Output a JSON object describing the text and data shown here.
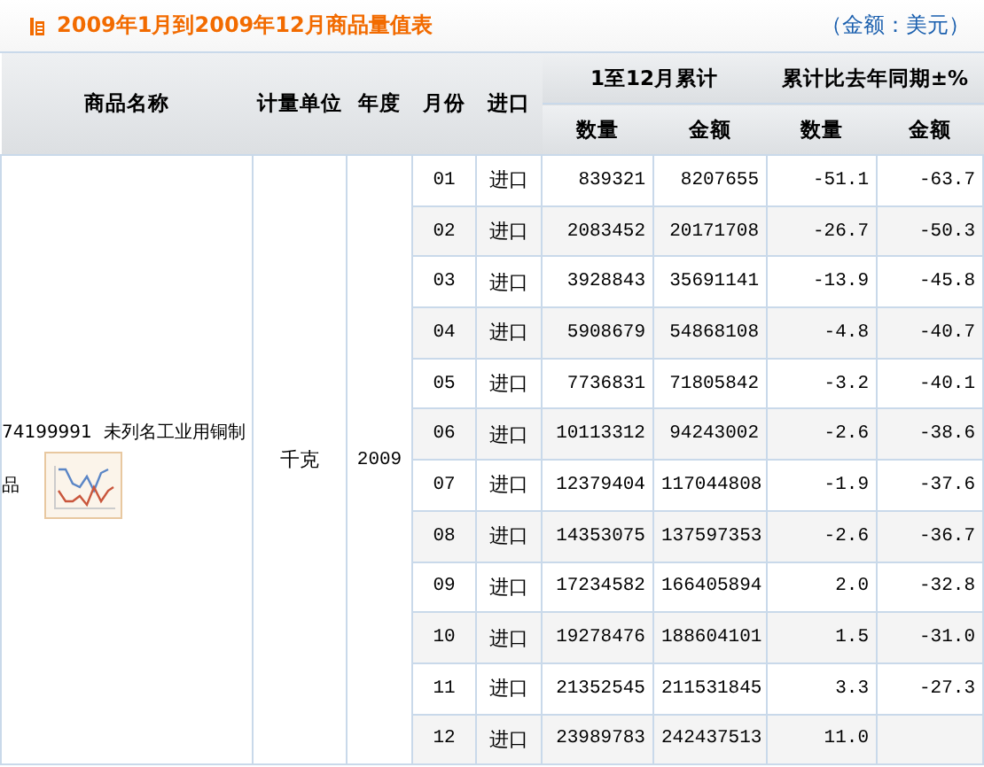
{
  "title": "2009年1月到2009年12月商品量值表",
  "currency_note": "（金额：美元）",
  "header": {
    "name": "商品名称",
    "unit": "计量单位",
    "year": "年度",
    "month": "月份",
    "trade": "进口",
    "cumulative": "1至12月累计",
    "change": "累计比去年同期±%",
    "quantity": "数量",
    "amount": "金额",
    "change_quantity": "数量",
    "change_amount": "金额"
  },
  "product": {
    "code": "74199991",
    "name_line1": "未列名工业用铜制",
    "name_line2": "品",
    "unit": "千克",
    "year": "2009"
  },
  "rows": [
    {
      "month": "01",
      "trade": "进口",
      "quantity": "839321",
      "amount": "8207655",
      "change_quantity": "-51.1",
      "change_amount": "-63.7"
    },
    {
      "month": "02",
      "trade": "进口",
      "quantity": "2083452",
      "amount": "20171708",
      "change_quantity": "-26.7",
      "change_amount": "-50.3"
    },
    {
      "month": "03",
      "trade": "进口",
      "quantity": "3928843",
      "amount": "35691141",
      "change_quantity": "-13.9",
      "change_amount": "-45.8"
    },
    {
      "month": "04",
      "trade": "进口",
      "quantity": "5908679",
      "amount": "54868108",
      "change_quantity": "-4.8",
      "change_amount": "-40.7"
    },
    {
      "month": "05",
      "trade": "进口",
      "quantity": "7736831",
      "amount": "71805842",
      "change_quantity": "-3.2",
      "change_amount": "-40.1"
    },
    {
      "month": "06",
      "trade": "进口",
      "quantity": "10113312",
      "amount": "94243002",
      "change_quantity": "-2.6",
      "change_amount": "-38.6"
    },
    {
      "month": "07",
      "trade": "进口",
      "quantity": "12379404",
      "amount": "117044808",
      "change_quantity": "-1.9",
      "change_amount": "-37.6"
    },
    {
      "month": "08",
      "trade": "进口",
      "quantity": "14353075",
      "amount": "137597353",
      "change_quantity": "-2.6",
      "change_amount": "-36.7"
    },
    {
      "month": "09",
      "trade": "进口",
      "quantity": "17234582",
      "amount": "166405894",
      "change_quantity": "2.0",
      "change_amount": "-32.8"
    },
    {
      "month": "10",
      "trade": "进口",
      "quantity": "19278476",
      "amount": "188604101",
      "change_quantity": "1.5",
      "change_amount": "-31.0"
    },
    {
      "month": "11",
      "trade": "进口",
      "quantity": "21352545",
      "amount": "211531845",
      "change_quantity": "3.3",
      "change_amount": "-27.3"
    },
    {
      "month": "12",
      "trade": "进口",
      "quantity": "23989783",
      "amount": "242437513",
      "change_quantity": "11.0"
    }
  ]
}
